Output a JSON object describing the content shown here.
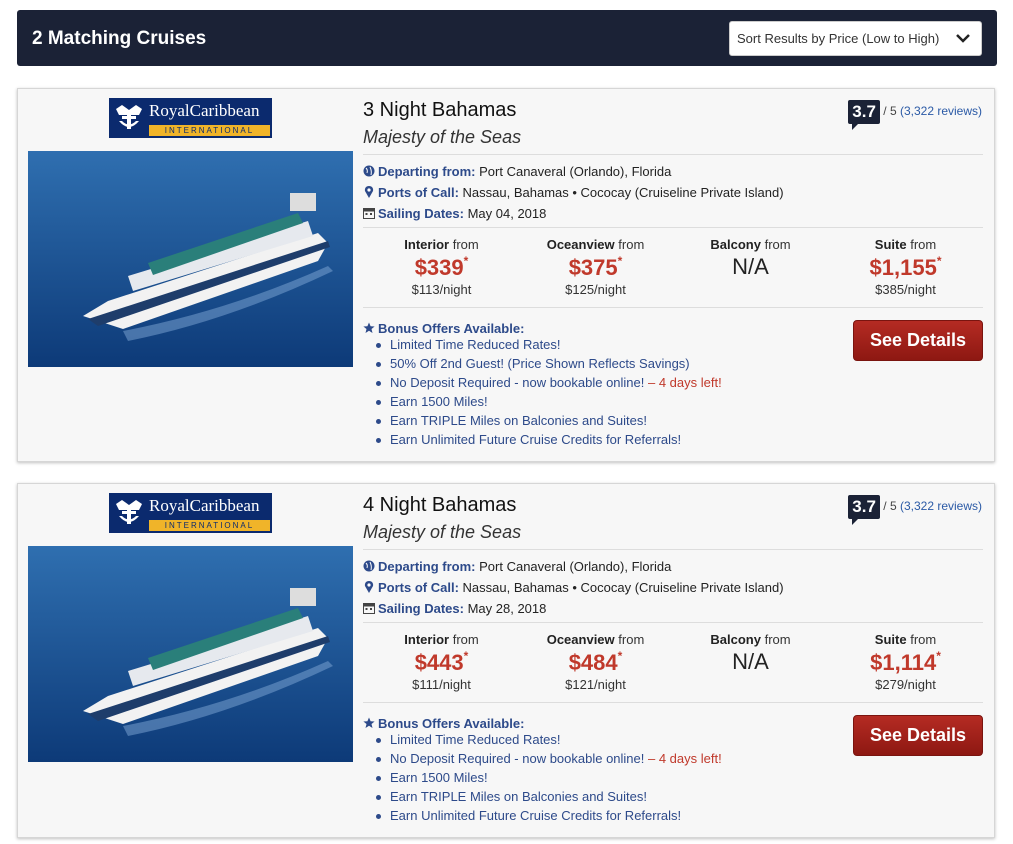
{
  "header": {
    "results_count": "2 Matching Cruises",
    "sort_value": "Sort Results by Price (Low to High)"
  },
  "colors": {
    "navy": "#1b2236",
    "price_red": "#c0392b",
    "link_blue": "#2d4a8a",
    "button_red": "#a0221b"
  },
  "labels": {
    "departing": "Departing from:",
    "ports": "Ports of Call:",
    "sailing": "Sailing Dates:",
    "bonus": "Bonus Offers Available:",
    "from": "from",
    "see_details": "See Details",
    "rating_of": "/ 5"
  },
  "logo": {
    "brand": "RoyalCaribbean",
    "sub": "INTERNATIONAL"
  },
  "cruises": [
    {
      "title": "3 Night Bahamas",
      "ship": "Majesty of the Seas",
      "rating": "3.7",
      "reviews": "(3,322 reviews)",
      "departing": "Port Canaveral (Orlando), Florida",
      "ports": "Nassau, Bahamas • Cococay (Cruiseline Private Island)",
      "sailing": "May 04, 2018",
      "prices": [
        {
          "cabin": "Interior",
          "price": "$339",
          "per_night": "$113/night"
        },
        {
          "cabin": "Oceanview",
          "price": "$375",
          "per_night": "$125/night"
        },
        {
          "cabin": "Balcony",
          "price": "N/A",
          "per_night": ""
        },
        {
          "cabin": "Suite",
          "price": "$1,155",
          "per_night": "$385/night"
        }
      ],
      "offers": [
        {
          "text": "Limited Time Reduced Rates!",
          "extra": ""
        },
        {
          "text": "50% Off 2nd Guest! (Price Shown Reflects Savings)",
          "extra": ""
        },
        {
          "text": "No Deposit Required - now bookable online!",
          "extra": " – 4 days left!"
        },
        {
          "text": "Earn 1500 Miles!",
          "extra": ""
        },
        {
          "text": "Earn TRIPLE Miles on Balconies and Suites!",
          "extra": ""
        },
        {
          "text": "Earn Unlimited Future Cruise Credits for Referrals!",
          "extra": ""
        }
      ]
    },
    {
      "title": "4 Night Bahamas",
      "ship": "Majesty of the Seas",
      "rating": "3.7",
      "reviews": "(3,322 reviews)",
      "departing": "Port Canaveral (Orlando), Florida",
      "ports": "Nassau, Bahamas • Cococay (Cruiseline Private Island)",
      "sailing": "May 28, 2018",
      "prices": [
        {
          "cabin": "Interior",
          "price": "$443",
          "per_night": "$111/night"
        },
        {
          "cabin": "Oceanview",
          "price": "$484",
          "per_night": "$121/night"
        },
        {
          "cabin": "Balcony",
          "price": "N/A",
          "per_night": ""
        },
        {
          "cabin": "Suite",
          "price": "$1,114",
          "per_night": "$279/night"
        }
      ],
      "offers": [
        {
          "text": "Limited Time Reduced Rates!",
          "extra": ""
        },
        {
          "text": "No Deposit Required - now bookable online!",
          "extra": " – 4 days left!"
        },
        {
          "text": "Earn 1500 Miles!",
          "extra": ""
        },
        {
          "text": "Earn TRIPLE Miles on Balconies and Suites!",
          "extra": ""
        },
        {
          "text": "Earn Unlimited Future Cruise Credits for Referrals!",
          "extra": ""
        }
      ]
    }
  ]
}
